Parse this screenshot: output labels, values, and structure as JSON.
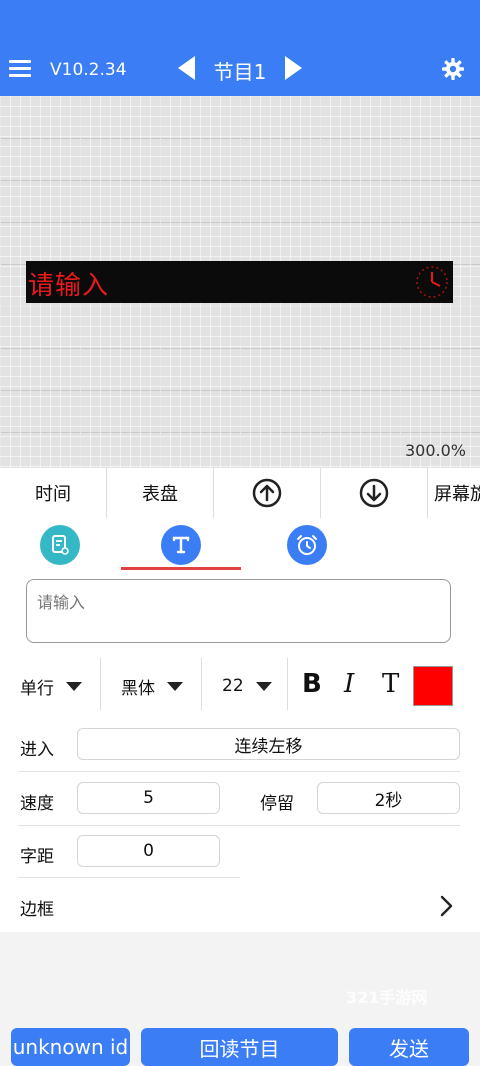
{
  "header": {
    "version": "V10.2.34",
    "program_title": "节目1"
  },
  "canvas": {
    "led_text": "请输入",
    "zoom": "300.0%"
  },
  "toolbar": {
    "items": [
      "时间",
      "表盘",
      "屏幕旋"
    ]
  },
  "tabs": {
    "active_index": 1
  },
  "text_input": {
    "placeholder": "请输入",
    "value": ""
  },
  "font_row": {
    "line_mode": "单行",
    "font": "黑体",
    "size": "22",
    "bold_label": "B",
    "italic_label": "I",
    "text_label": "T",
    "color": "#ff0000"
  },
  "settings": {
    "enter_label": "进入",
    "enter_value": "连续左移",
    "speed_label": "速度",
    "speed_value": "5",
    "stay_label": "停留",
    "stay_value": "2秒",
    "spacing_label": "字距",
    "spacing_value": "0",
    "border_label": "边框"
  },
  "watermark": "321手游网",
  "bottom_buttons": {
    "left": "unknown id",
    "middle": "回读节目",
    "right": "发送"
  },
  "colors": {
    "accent": "#3b7df5",
    "led_red": "#e81a1a",
    "tab_underline": "#e34040"
  }
}
